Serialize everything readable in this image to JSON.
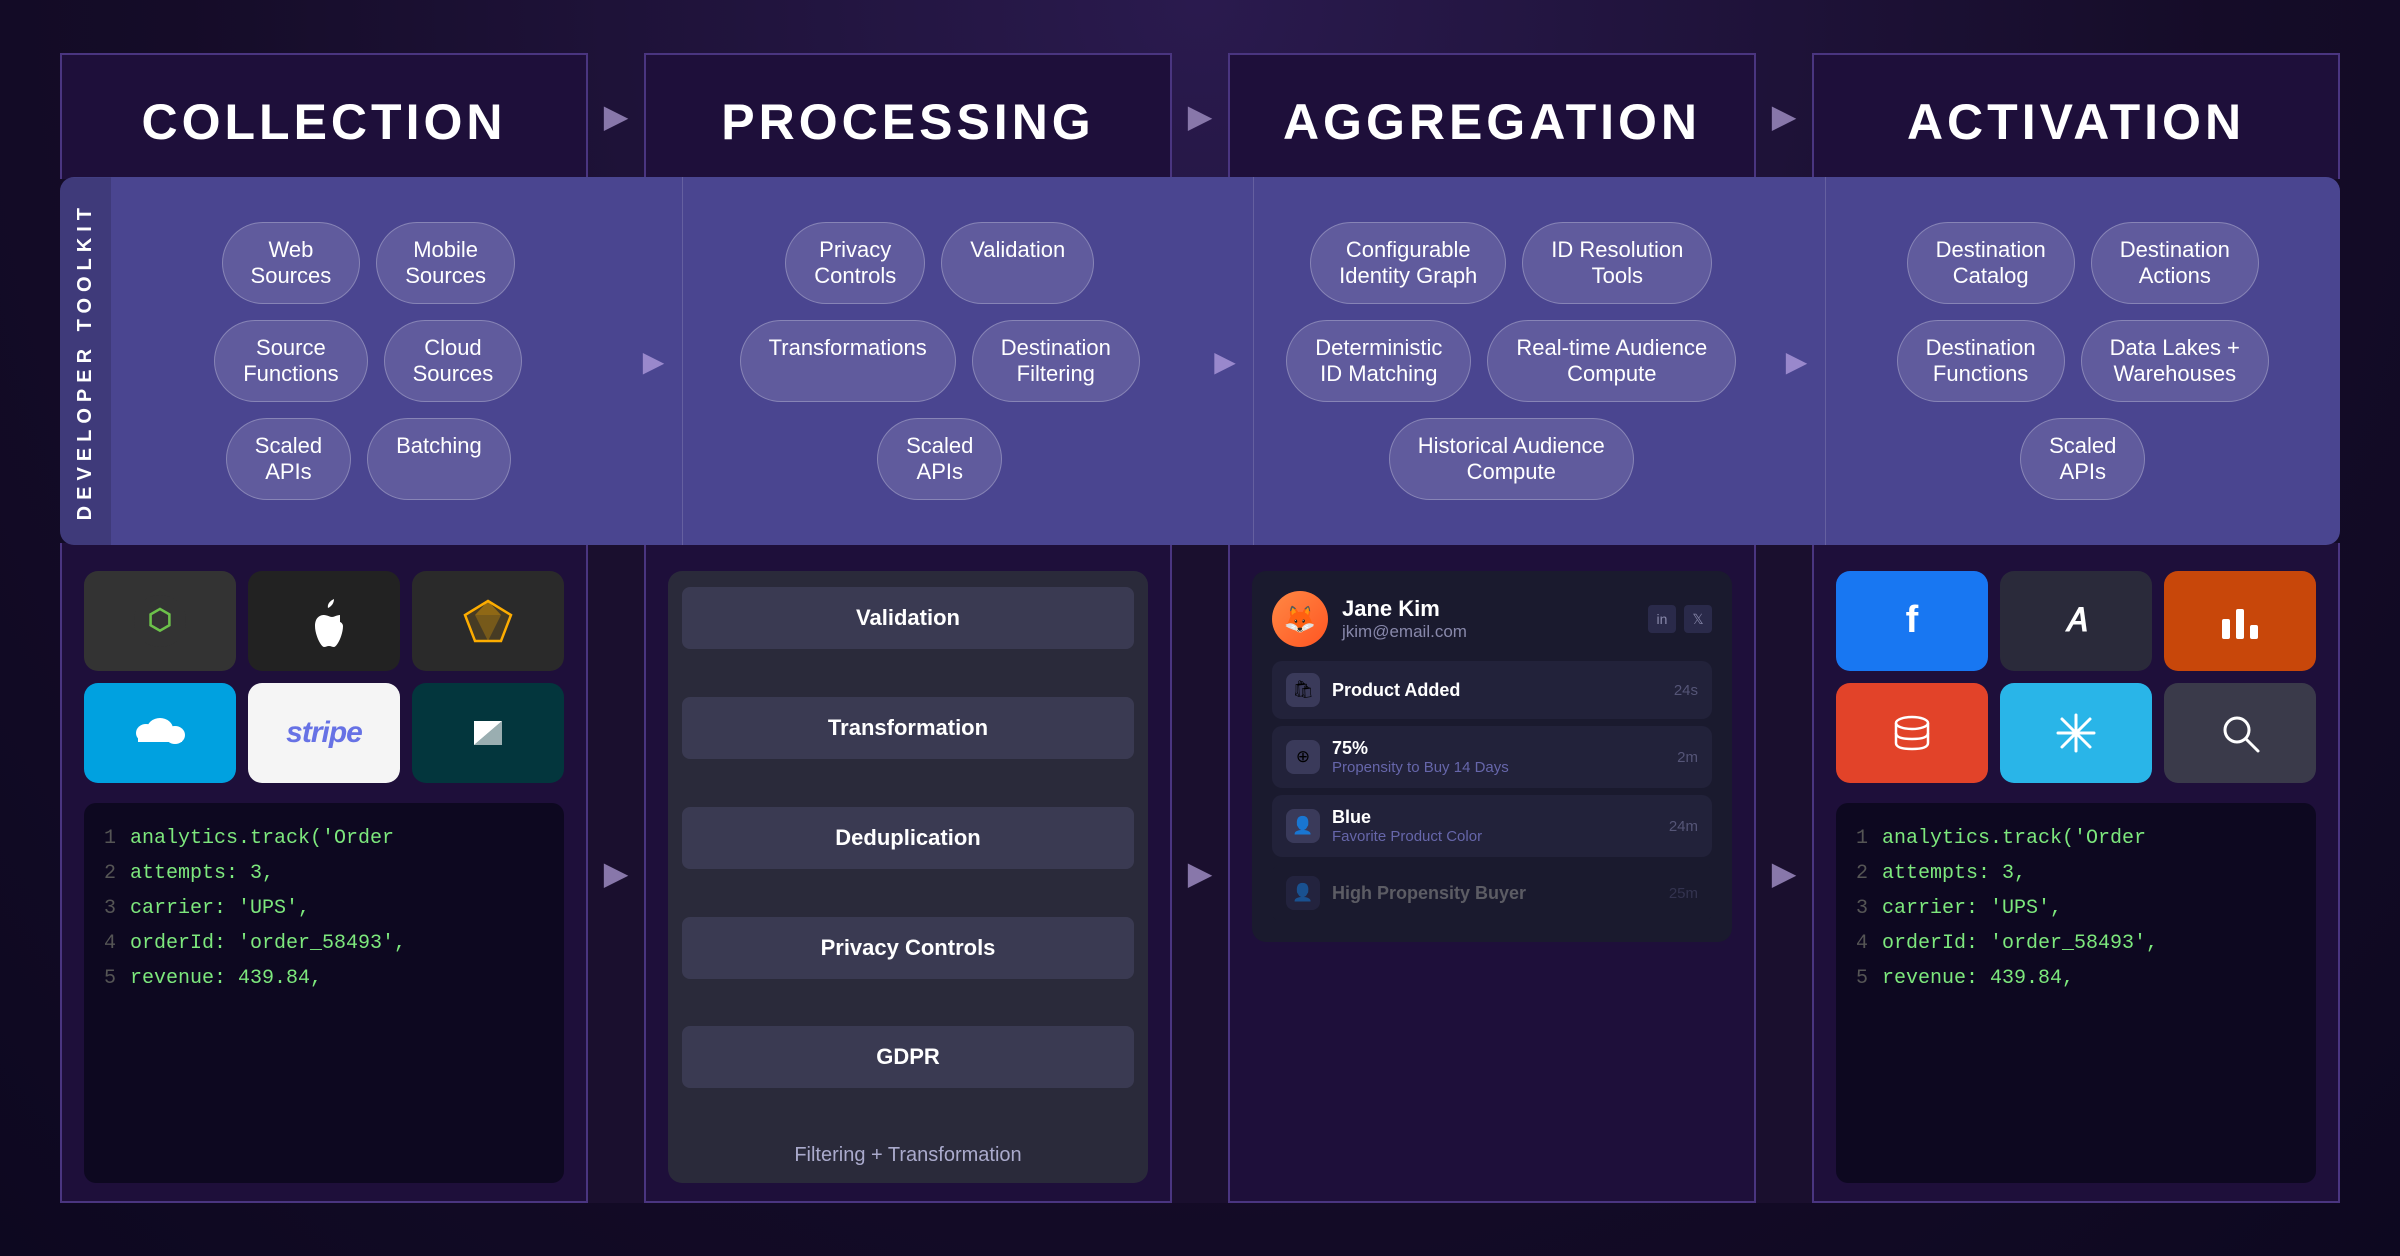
{
  "headers": {
    "collection": "COLLECTION",
    "processing": "PROCESSING",
    "aggregation": "AGGREGATION",
    "activation": "ACTIVATION"
  },
  "toolkit_label": "DEVELOPER TOOLKIT",
  "toolkit": {
    "collection": {
      "rows": [
        [
          "Web Sources",
          "Mobile Sources"
        ],
        [
          "Source Functions",
          "Cloud Sources"
        ],
        [
          "Scaled APIs",
          "Batching"
        ]
      ]
    },
    "processing": {
      "rows": [
        [
          "Privacy Controls",
          "Validation"
        ],
        [
          "Transformations",
          "Destination Filtering"
        ],
        [
          "Scaled APIs"
        ]
      ]
    },
    "aggregation": {
      "rows": [
        [
          "Configurable Identity Graph",
          "ID Resolution Tools"
        ],
        [
          "Deterministic ID Matching",
          "Real-time Audience Compute"
        ],
        [
          "Historical Audience Compute"
        ]
      ]
    },
    "activation": {
      "rows": [
        [
          "Destination Catalog",
          "Destination Actions"
        ],
        [
          "Destination Functions",
          "Data Lakes + Warehouses"
        ],
        [
          "Scaled APIs"
        ]
      ]
    }
  },
  "arrows": [
    "▶",
    "▶",
    "▶"
  ],
  "bottom": {
    "collection": {
      "icons": [
        "node",
        "apple",
        "sketch",
        "salesforce",
        "stripe",
        "zendesk"
      ],
      "code": [
        {
          "num": "1",
          "text": "analytics.track('Order"
        },
        {
          "num": "2",
          "text": "attempts: 3,"
        },
        {
          "num": "3",
          "text": "carrier: 'UPS',"
        },
        {
          "num": "4",
          "text": "orderId: 'order_58493',"
        },
        {
          "num": "5",
          "text": "revenue: 439.84,"
        }
      ]
    },
    "processing": {
      "items": [
        "Validation",
        "Transformation",
        "Deduplication",
        "Privacy Controls",
        "GDPR"
      ],
      "label": "Filtering + Transformation"
    },
    "aggregation": {
      "profile": {
        "name": "Jane Kim",
        "email": "jkim@email.com",
        "avatar": "🦊"
      },
      "traits": [
        {
          "icon": "🛍",
          "title": "Product Added",
          "time": "24s"
        },
        {
          "icon": "⊕",
          "title": "75%",
          "sub": "Propensity to Buy 14 Days",
          "time": "2m"
        },
        {
          "icon": "👤",
          "title": "Blue",
          "sub": "Favorite Product Color",
          "time": "24m"
        },
        {
          "icon": "👤",
          "title": "High Propensity Buyer",
          "time": "25m"
        }
      ]
    },
    "activation": {
      "icons": [
        "facebook",
        "apptype",
        "barchart",
        "database",
        "snowflake",
        "searchglass"
      ],
      "code": [
        {
          "num": "1",
          "text": "analytics.track('Order"
        },
        {
          "num": "2",
          "text": "attempts: 3,"
        },
        {
          "num": "3",
          "text": "carrier: 'UPS',"
        },
        {
          "num": "4",
          "text": "orderId: 'order_58493',"
        },
        {
          "num": "5",
          "text": "revenue: 439.84,"
        }
      ]
    }
  },
  "colors": {
    "bg": "#1a0f2e",
    "card_bg": "#1e0f3a",
    "border": "#4a3580",
    "toolkit_bg": "#4a4580",
    "pill_bg": "rgba(255,255,255,0.12)",
    "text_white": "#ffffff",
    "text_dim": "#8888aa",
    "code_green": "#7de87d",
    "proc_bg": "#3a3a50"
  }
}
